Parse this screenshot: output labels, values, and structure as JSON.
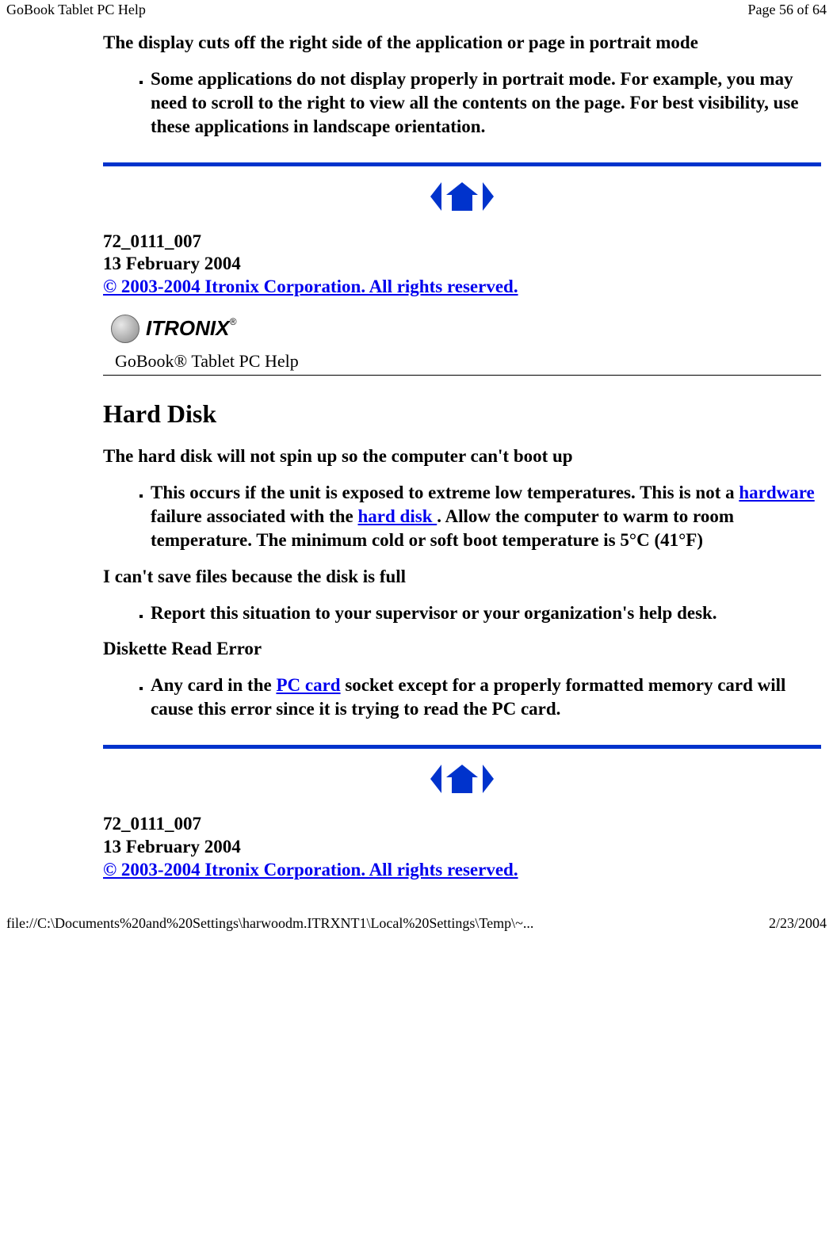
{
  "header": {
    "title": "GoBook Tablet PC Help",
    "page_info": "Page 56 of 64"
  },
  "section1": {
    "issue": "The display cuts off the right side of the application or page in portrait mode",
    "bullet": "Some applications do not display properly in portrait mode.  For example, you may need to scroll to the right to view all the contents on the page.  For best visibility, use these applications in landscape orientation."
  },
  "docinfo": {
    "code": "72_0111_007",
    "date": "13 February 2004",
    "copyright": "© 2003-2004 Itronix Corporation.  All rights reserved."
  },
  "logo": {
    "text": "ITRONIX",
    "reg": "®"
  },
  "brand_line": "GoBook® Tablet PC Help",
  "section2": {
    "heading": "Hard Disk",
    "issue1": "The hard disk will not spin up so the computer can't boot up",
    "bullet1_pre": "This occurs if the unit is exposed to extreme low temperatures. This is not a ",
    "bullet1_link1": "hardware",
    "bullet1_mid": " failure associated with the ",
    "bullet1_link2": "hard disk ",
    "bullet1_post": ".  Allow the computer to warm to room temperature.  The minimum cold or soft boot temperature is 5°C (41°F)",
    "issue2": "I can't save files because the disk is full",
    "bullet2": "Report this situation to your supervisor or your organization's help desk.",
    "issue3": "Diskette Read Error",
    "bullet3_pre": "Any card in the ",
    "bullet3_link": "PC card",
    "bullet3_post": " socket except for a properly formatted memory card will cause this error since it is trying to read the PC card."
  },
  "footer": {
    "path": "file://C:\\Documents%20and%20Settings\\harwoodm.ITRXNT1\\Local%20Settings\\Temp\\~...",
    "date": "2/23/2004"
  }
}
